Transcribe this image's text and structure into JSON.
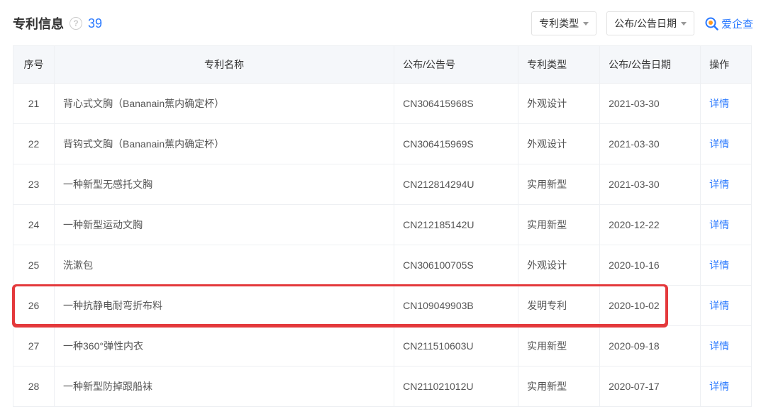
{
  "header": {
    "title": "专利信息",
    "help_icon_char": "?",
    "count": "39"
  },
  "filters": [
    {
      "label": "专利类型"
    },
    {
      "label": "公布/公告日期"
    }
  ],
  "brand": {
    "name": "爱企查"
  },
  "table": {
    "columns": [
      "序号",
      "专利名称",
      "公布/公告号",
      "专利类型",
      "公布/公告日期",
      "操作"
    ],
    "action_label": "详情",
    "rows": [
      {
        "idx": "21",
        "name": "背心式文胸（Bananain蕉内确定杯）",
        "pub_no": "CN306415968S",
        "type": "外观设计",
        "date": "2021-03-30"
      },
      {
        "idx": "22",
        "name": "背钩式文胸（Bananain蕉内确定杯）",
        "pub_no": "CN306415969S",
        "type": "外观设计",
        "date": "2021-03-30"
      },
      {
        "idx": "23",
        "name": "一种新型无感托文胸",
        "pub_no": "CN212814294U",
        "type": "实用新型",
        "date": "2021-03-30"
      },
      {
        "idx": "24",
        "name": "一种新型运动文胸",
        "pub_no": "CN212185142U",
        "type": "实用新型",
        "date": "2020-12-22"
      },
      {
        "idx": "25",
        "name": "洗漱包",
        "pub_no": "CN306100705S",
        "type": "外观设计",
        "date": "2020-10-16"
      },
      {
        "idx": "26",
        "name": "一种抗静电耐弯折布料",
        "pub_no": "CN109049903B",
        "type": "发明专利",
        "date": "2020-10-02",
        "highlight": true
      },
      {
        "idx": "27",
        "name": "一种360°弹性内衣",
        "pub_no": "CN211510603U",
        "type": "实用新型",
        "date": "2020-09-18"
      },
      {
        "idx": "28",
        "name": "一种新型防掉跟船袜",
        "pub_no": "CN211021012U",
        "type": "实用新型",
        "date": "2020-07-17"
      }
    ]
  }
}
